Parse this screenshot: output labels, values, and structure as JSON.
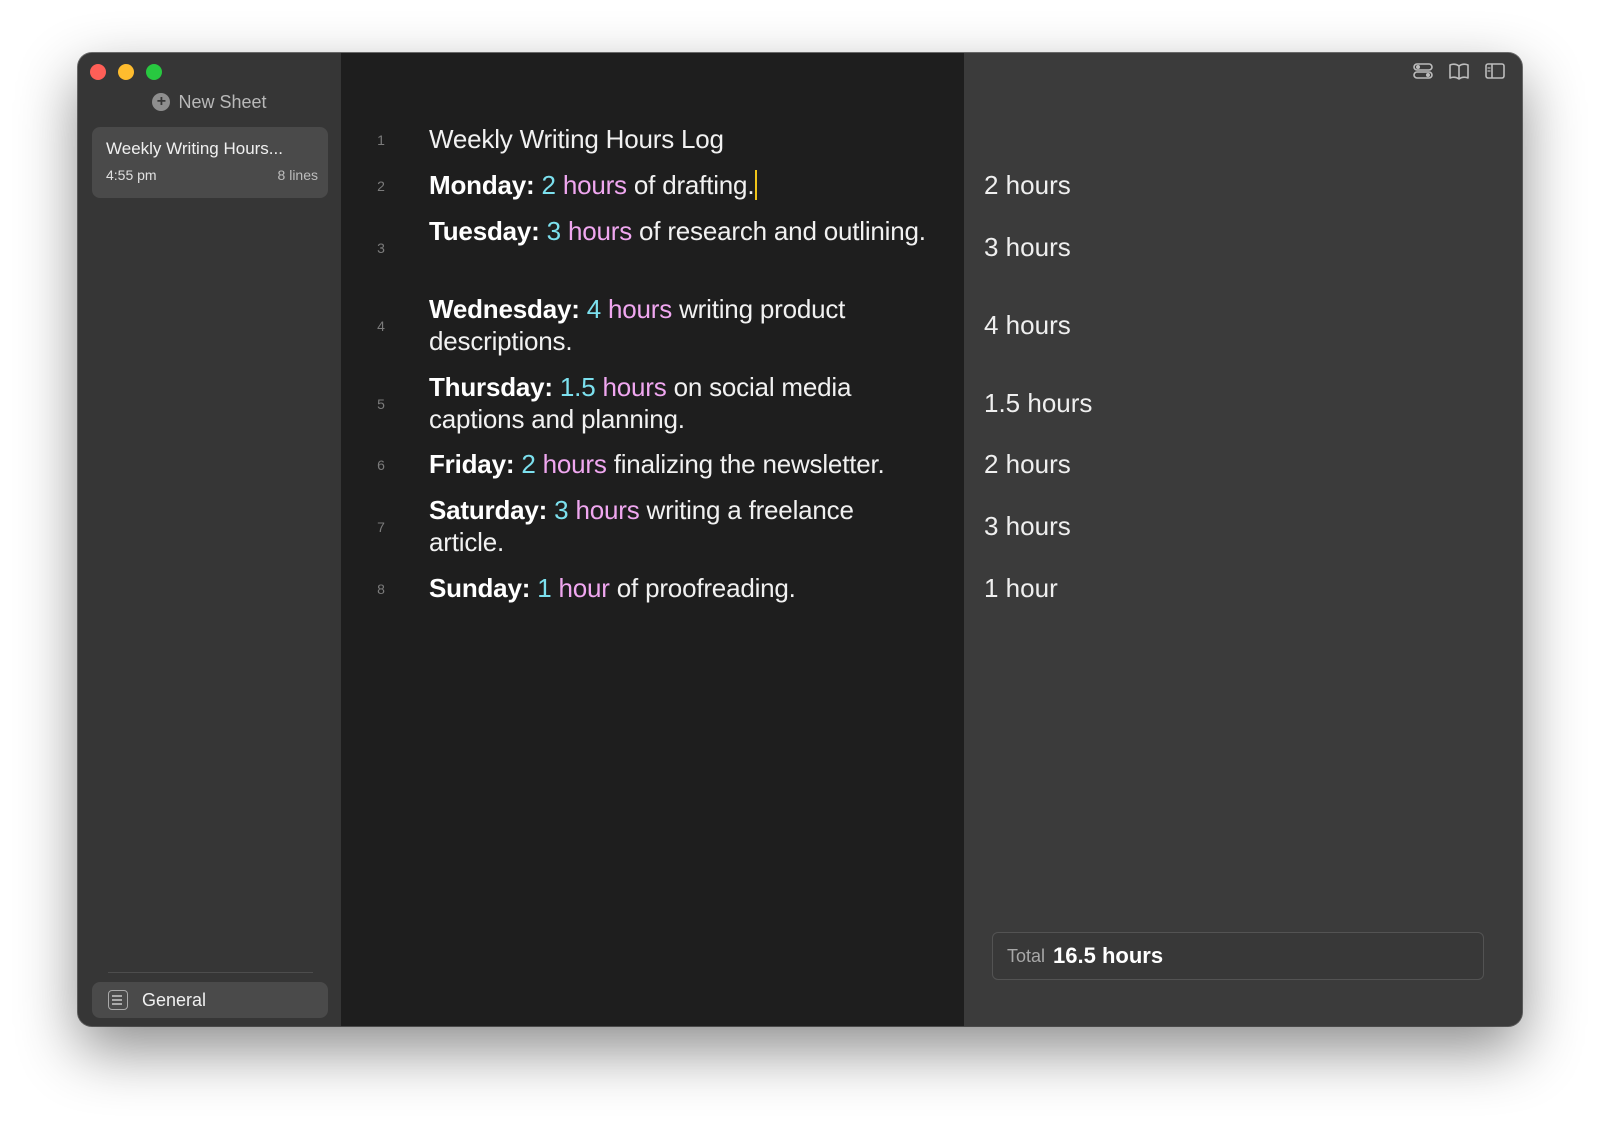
{
  "sidebar": {
    "new_sheet_label": "New Sheet",
    "sheets": [
      {
        "title": "Weekly Writing Hours...",
        "time": "4:55 pm",
        "lines": "8 lines"
      }
    ],
    "library_label": "General"
  },
  "editor": {
    "lines": [
      {
        "n": "1",
        "label": "",
        "num": "",
        "unit": "",
        "rest": "Weekly Writing Hours Log"
      },
      {
        "n": "2",
        "label": "Monday:",
        "num": "2",
        "unit": "hours",
        "rest": "of drafting."
      },
      {
        "n": "3",
        "label": "Tuesday:",
        "num": "3",
        "unit": "hours",
        "rest": "of research and outlining."
      },
      {
        "n": "4",
        "label": "Wednesday:",
        "num": "4",
        "unit": "hours",
        "rest": "writing product descriptions."
      },
      {
        "n": "5",
        "label": "Thursday:",
        "num": "1.5",
        "unit": "hours",
        "rest": "on social media captions and planning."
      },
      {
        "n": "6",
        "label": "Friday:",
        "num": "2",
        "unit": "hours",
        "rest": "finalizing the newsletter."
      },
      {
        "n": "7",
        "label": "Saturday:",
        "num": "3",
        "unit": "hours",
        "rest": "writing a freelance article."
      },
      {
        "n": "8",
        "label": "Sunday:",
        "num": "1",
        "unit": "hour",
        "rest": "of proofreading."
      }
    ]
  },
  "results": {
    "values": [
      "2 hours",
      "3 hours",
      "4 hours",
      "1.5 hours",
      "2 hours",
      "3 hours",
      "1 hour"
    ],
    "total_label": "Total",
    "total_value": "16.5 hours"
  },
  "colors": {
    "number": "#7ce0ee",
    "unit": "#f0a7f0",
    "cursor": "#f0c419",
    "editor_bg": "#1e1e1e",
    "results_bg": "#3b3b3b"
  },
  "icons": [
    "toggle-icon",
    "book-icon",
    "sidebar-icon",
    "plus-circle-icon",
    "sheet-library-icon"
  ]
}
